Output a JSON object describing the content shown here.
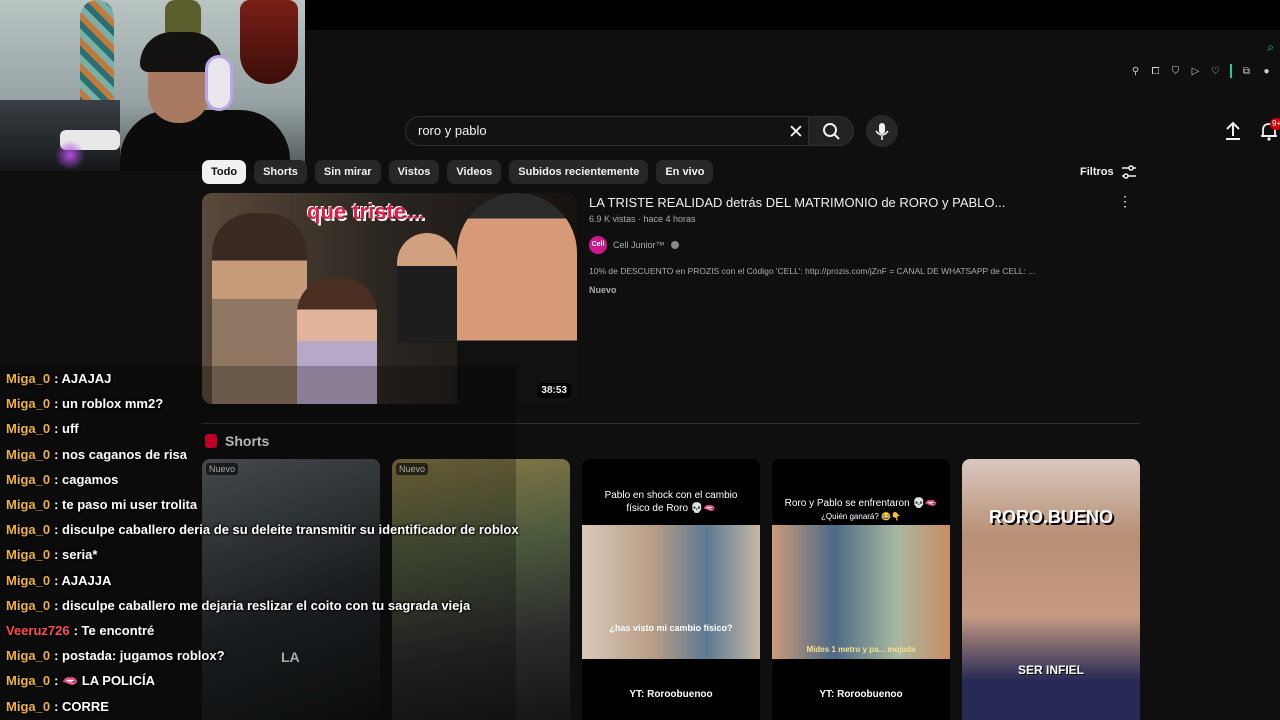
{
  "search": {
    "query": "roro y pablo"
  },
  "notifications": {
    "badge": "9+"
  },
  "chips": [
    "Todo",
    "Shorts",
    "Sin mirar",
    "Vistos",
    "Videos",
    "Subidos recientemente",
    "En vivo"
  ],
  "filters_label": "Filtros",
  "video": {
    "title": "LA TRISTE REALIDAD detrás DEL MATRIMONIO de RORO y PABLO...",
    "meta": "6.9 K vistas · hace 4 horas",
    "channel": "Cell Junior™",
    "channel_avatar": "Cell",
    "description": "10% de DESCUENTO en PROZIS con el Código 'CELL': http://prozis.com/jZnF = CANAL DE WHATSAPP de CELL: ...",
    "badge": "Nuevo",
    "duration": "38:53",
    "thumb_text": "que triste..."
  },
  "shorts_header": "Shorts",
  "shorts": [
    {
      "badge": "Nuevo",
      "top": "",
      "question": "",
      "bottom": ""
    },
    {
      "badge": "Nuevo",
      "top": "",
      "question": "",
      "bottom": ""
    },
    {
      "badge": "",
      "top": "Pablo en shock con el cambio físico de Roro 💀🫦",
      "question": "¿has visto mi cambio físico?",
      "bottom": "YT: Roroobuenoo"
    },
    {
      "badge": "",
      "top": "Roro y Pablo se enfrentaron 💀🫦",
      "sub": "¿Quién ganará? 😂👇",
      "question": "Mides 1 metro y pa... mojada",
      "bottom": "YT: Roroobuenoo"
    },
    {
      "badge": "",
      "top": "RORO.BUENO",
      "question": "SER INFIEL",
      "bottom": ""
    }
  ],
  "chat": [
    {
      "user": "Miga_0",
      "color": "#f2b33d",
      "msg": ": AJAJAJ"
    },
    {
      "user": "Miga_0",
      "color": "#f2b33d",
      "msg": ": un roblox mm2?"
    },
    {
      "user": "Miga_0",
      "color": "#f2b33d",
      "msg": ": uff"
    },
    {
      "user": "Miga_0",
      "color": "#f2b33d",
      "msg": ": nos caganos de risa"
    },
    {
      "user": "Miga_0",
      "color": "#f2b33d",
      "msg": ": cagamos"
    },
    {
      "user": "Miga_0",
      "color": "#f2b33d",
      "msg": ": te paso mi user trolita"
    },
    {
      "user": "Miga_0",
      "color": "#f2b33d",
      "msg": ": disculpe caballero deria de su deleite transmitir su identificador de roblox"
    },
    {
      "user": "Miga_0",
      "color": "#f2b33d",
      "msg": ": seria*"
    },
    {
      "user": "Miga_0",
      "color": "#f2b33d",
      "msg": ": AJAJJA"
    },
    {
      "user": "Miga_0",
      "color": "#f2b33d",
      "msg": ": disculpe caballero me dejaria reslizar el coito con tu sagrada vieja"
    },
    {
      "user": "Veeruz726",
      "color": "#ff4d4d",
      "msg": ": Te encontré"
    },
    {
      "user": "Miga_0",
      "color": "#f2b33d",
      "msg": ": postada: jugamos roblox?"
    },
    {
      "user": "Miga_0",
      "color": "#f2b33d",
      "msg": ": 🫦 LA POLICÍA"
    },
    {
      "user": "Miga_0",
      "color": "#f2b33d",
      "msg": ": CORRE"
    }
  ],
  "overlay_text": "LA"
}
